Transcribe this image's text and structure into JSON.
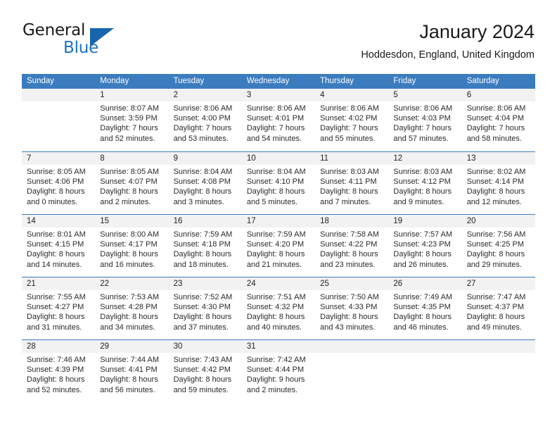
{
  "brand": {
    "name_part1": "General",
    "name_part2": "Blue",
    "triangle_icon": "logo-triangle",
    "accent_color": "#1d72bf",
    "triangle_color": "#1766ad"
  },
  "header": {
    "title": "January 2024",
    "subtitle": "Hoddesdon, England, United Kingdom"
  },
  "calendar": {
    "header_bg": "#3b7cbf",
    "day_band_bg": "#f2f2f2",
    "weekdays": [
      "Sunday",
      "Monday",
      "Tuesday",
      "Wednesday",
      "Thursday",
      "Friday",
      "Saturday"
    ],
    "weeks": [
      [
        {
          "date": "",
          "lines": []
        },
        {
          "date": "1",
          "lines": [
            "Sunrise: 8:07 AM",
            "Sunset: 3:59 PM",
            "Daylight: 7 hours",
            "and 52 minutes."
          ]
        },
        {
          "date": "2",
          "lines": [
            "Sunrise: 8:06 AM",
            "Sunset: 4:00 PM",
            "Daylight: 7 hours",
            "and 53 minutes."
          ]
        },
        {
          "date": "3",
          "lines": [
            "Sunrise: 8:06 AM",
            "Sunset: 4:01 PM",
            "Daylight: 7 hours",
            "and 54 minutes."
          ]
        },
        {
          "date": "4",
          "lines": [
            "Sunrise: 8:06 AM",
            "Sunset: 4:02 PM",
            "Daylight: 7 hours",
            "and 55 minutes."
          ]
        },
        {
          "date": "5",
          "lines": [
            "Sunrise: 8:06 AM",
            "Sunset: 4:03 PM",
            "Daylight: 7 hours",
            "and 57 minutes."
          ]
        },
        {
          "date": "6",
          "lines": [
            "Sunrise: 8:06 AM",
            "Sunset: 4:04 PM",
            "Daylight: 7 hours",
            "and 58 minutes."
          ]
        }
      ],
      [
        {
          "date": "7",
          "lines": [
            "Sunrise: 8:05 AM",
            "Sunset: 4:06 PM",
            "Daylight: 8 hours",
            "and 0 minutes."
          ]
        },
        {
          "date": "8",
          "lines": [
            "Sunrise: 8:05 AM",
            "Sunset: 4:07 PM",
            "Daylight: 8 hours",
            "and 2 minutes."
          ]
        },
        {
          "date": "9",
          "lines": [
            "Sunrise: 8:04 AM",
            "Sunset: 4:08 PM",
            "Daylight: 8 hours",
            "and 3 minutes."
          ]
        },
        {
          "date": "10",
          "lines": [
            "Sunrise: 8:04 AM",
            "Sunset: 4:10 PM",
            "Daylight: 8 hours",
            "and 5 minutes."
          ]
        },
        {
          "date": "11",
          "lines": [
            "Sunrise: 8:03 AM",
            "Sunset: 4:11 PM",
            "Daylight: 8 hours",
            "and 7 minutes."
          ]
        },
        {
          "date": "12",
          "lines": [
            "Sunrise: 8:03 AM",
            "Sunset: 4:12 PM",
            "Daylight: 8 hours",
            "and 9 minutes."
          ]
        },
        {
          "date": "13",
          "lines": [
            "Sunrise: 8:02 AM",
            "Sunset: 4:14 PM",
            "Daylight: 8 hours",
            "and 12 minutes."
          ]
        }
      ],
      [
        {
          "date": "14",
          "lines": [
            "Sunrise: 8:01 AM",
            "Sunset: 4:15 PM",
            "Daylight: 8 hours",
            "and 14 minutes."
          ]
        },
        {
          "date": "15",
          "lines": [
            "Sunrise: 8:00 AM",
            "Sunset: 4:17 PM",
            "Daylight: 8 hours",
            "and 16 minutes."
          ]
        },
        {
          "date": "16",
          "lines": [
            "Sunrise: 7:59 AM",
            "Sunset: 4:18 PM",
            "Daylight: 8 hours",
            "and 18 minutes."
          ]
        },
        {
          "date": "17",
          "lines": [
            "Sunrise: 7:59 AM",
            "Sunset: 4:20 PM",
            "Daylight: 8 hours",
            "and 21 minutes."
          ]
        },
        {
          "date": "18",
          "lines": [
            "Sunrise: 7:58 AM",
            "Sunset: 4:22 PM",
            "Daylight: 8 hours",
            "and 23 minutes."
          ]
        },
        {
          "date": "19",
          "lines": [
            "Sunrise: 7:57 AM",
            "Sunset: 4:23 PM",
            "Daylight: 8 hours",
            "and 26 minutes."
          ]
        },
        {
          "date": "20",
          "lines": [
            "Sunrise: 7:56 AM",
            "Sunset: 4:25 PM",
            "Daylight: 8 hours",
            "and 29 minutes."
          ]
        }
      ],
      [
        {
          "date": "21",
          "lines": [
            "Sunrise: 7:55 AM",
            "Sunset: 4:27 PM",
            "Daylight: 8 hours",
            "and 31 minutes."
          ]
        },
        {
          "date": "22",
          "lines": [
            "Sunrise: 7:53 AM",
            "Sunset: 4:28 PM",
            "Daylight: 8 hours",
            "and 34 minutes."
          ]
        },
        {
          "date": "23",
          "lines": [
            "Sunrise: 7:52 AM",
            "Sunset: 4:30 PM",
            "Daylight: 8 hours",
            "and 37 minutes."
          ]
        },
        {
          "date": "24",
          "lines": [
            "Sunrise: 7:51 AM",
            "Sunset: 4:32 PM",
            "Daylight: 8 hours",
            "and 40 minutes."
          ]
        },
        {
          "date": "25",
          "lines": [
            "Sunrise: 7:50 AM",
            "Sunset: 4:33 PM",
            "Daylight: 8 hours",
            "and 43 minutes."
          ]
        },
        {
          "date": "26",
          "lines": [
            "Sunrise: 7:49 AM",
            "Sunset: 4:35 PM",
            "Daylight: 8 hours",
            "and 46 minutes."
          ]
        },
        {
          "date": "27",
          "lines": [
            "Sunrise: 7:47 AM",
            "Sunset: 4:37 PM",
            "Daylight: 8 hours",
            "and 49 minutes."
          ]
        }
      ],
      [
        {
          "date": "28",
          "lines": [
            "Sunrise: 7:46 AM",
            "Sunset: 4:39 PM",
            "Daylight: 8 hours",
            "and 52 minutes."
          ]
        },
        {
          "date": "29",
          "lines": [
            "Sunrise: 7:44 AM",
            "Sunset: 4:41 PM",
            "Daylight: 8 hours",
            "and 56 minutes."
          ]
        },
        {
          "date": "30",
          "lines": [
            "Sunrise: 7:43 AM",
            "Sunset: 4:42 PM",
            "Daylight: 8 hours",
            "and 59 minutes."
          ]
        },
        {
          "date": "31",
          "lines": [
            "Sunrise: 7:42 AM",
            "Sunset: 4:44 PM",
            "Daylight: 9 hours",
            "and 2 minutes."
          ]
        },
        {
          "date": "",
          "lines": []
        },
        {
          "date": "",
          "lines": []
        },
        {
          "date": "",
          "lines": []
        }
      ]
    ]
  }
}
